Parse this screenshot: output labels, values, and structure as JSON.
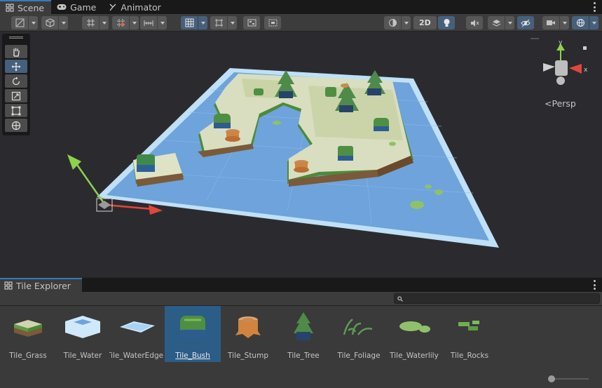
{
  "tabs": [
    {
      "label": "Scene",
      "icon": "scene-grid-icon",
      "active": true
    },
    {
      "label": "Game",
      "icon": "gamepad-icon",
      "active": false
    },
    {
      "label": "Animator",
      "icon": "animator-icon",
      "active": false
    }
  ],
  "toolbar": {
    "toggle_2d": "2D"
  },
  "gizmo": {
    "projection": "Persp",
    "axis_y": "y",
    "axis_x": "x"
  },
  "tools": [
    {
      "name": "hand-tool",
      "icon": "hand-icon"
    },
    {
      "name": "move-tool",
      "icon": "move-arrows-icon",
      "active": true
    },
    {
      "name": "rotate-tool",
      "icon": "rotate-icon"
    },
    {
      "name": "scale-tool",
      "icon": "scale-icon"
    },
    {
      "name": "rect-tool",
      "icon": "rect-icon"
    },
    {
      "name": "transform-tool",
      "icon": "transform-icon"
    }
  ],
  "panel": {
    "title": "Tile Explorer",
    "search_placeholder": ""
  },
  "tiles": [
    {
      "label": "Tile_Grass",
      "icon": "grass-tile-icon"
    },
    {
      "label": "Tile_Water",
      "icon": "water-tile-icon"
    },
    {
      "label": "Tile_WaterEdge",
      "icon": "water-edge-tile-icon"
    },
    {
      "label": "Tile_Bush",
      "icon": "bush-tile-icon",
      "selected": true
    },
    {
      "label": "Tile_Stump",
      "icon": "stump-tile-icon"
    },
    {
      "label": "Tile_Tree",
      "icon": "tree-tile-icon"
    },
    {
      "label": "Tile_Foliage",
      "icon": "foliage-tile-icon"
    },
    {
      "label": "Tile_Waterlily",
      "icon": "waterlily-tile-icon"
    },
    {
      "label": "Tile_Rocks",
      "icon": "rocks-tile-icon"
    }
  ],
  "zoom": {
    "value": 0.0
  },
  "colors": {
    "accent": "#3a79bb",
    "selected": "#2c5d87",
    "water": "#7fb5e6",
    "grass": "#8fc16a"
  }
}
